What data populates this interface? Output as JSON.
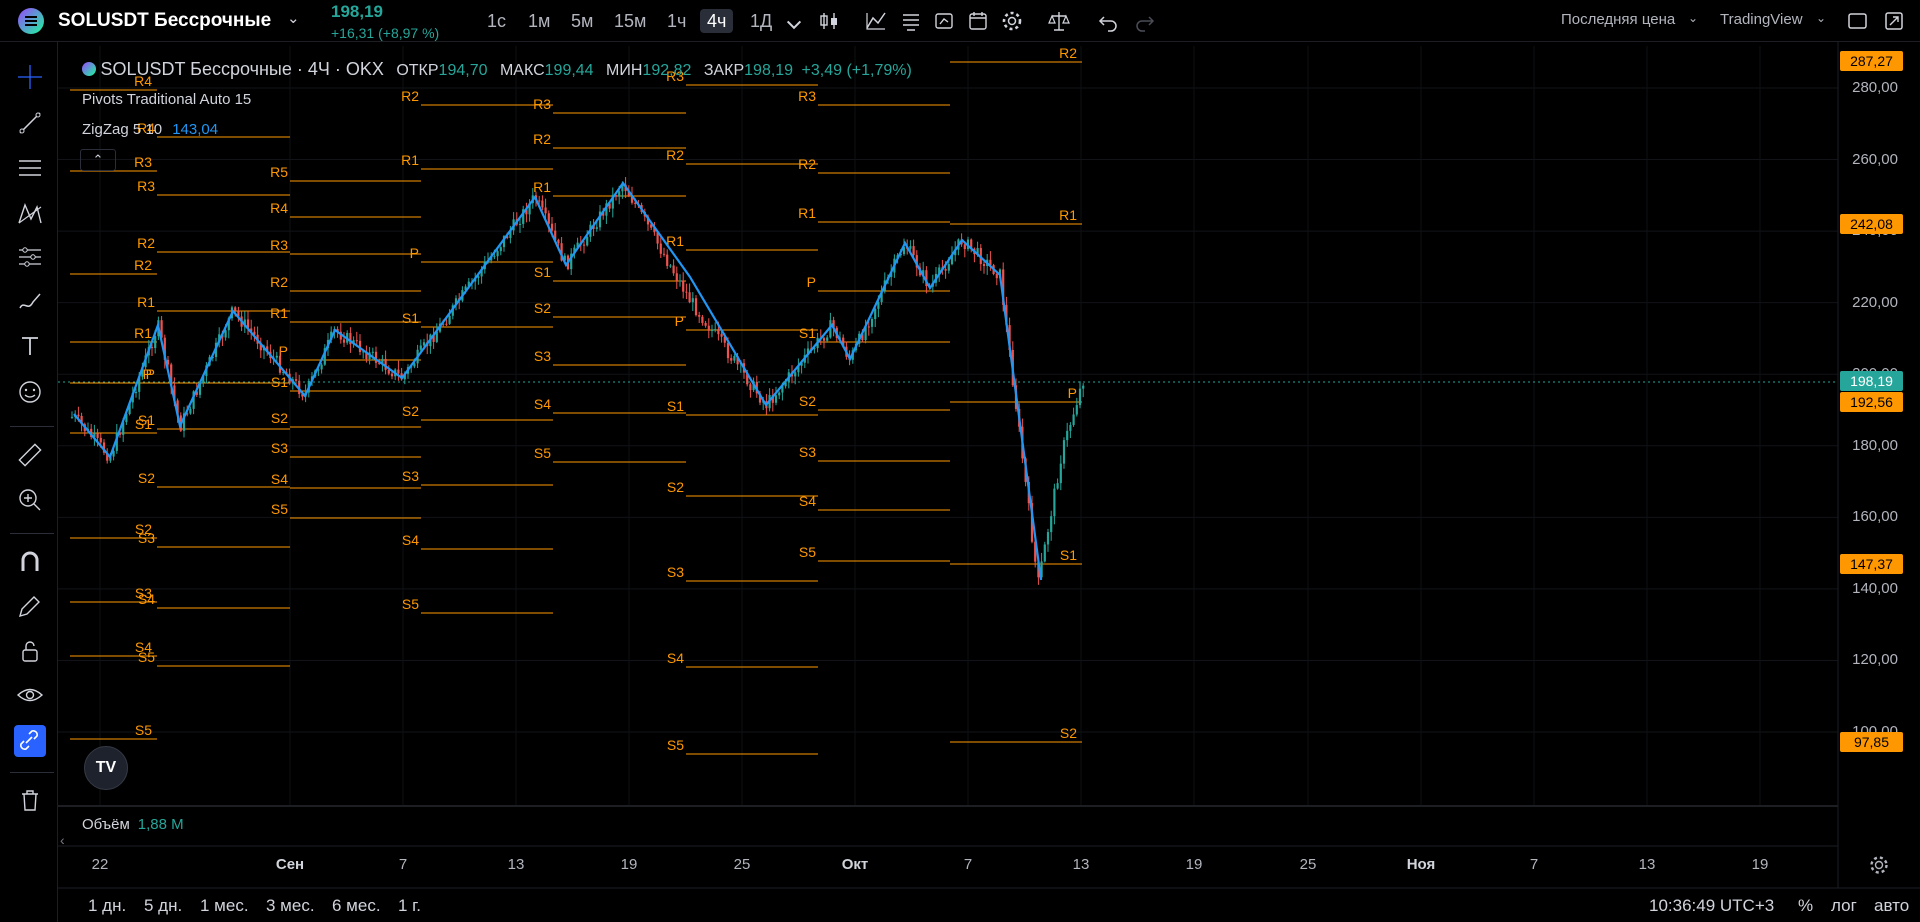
{
  "header": {
    "symbol": "SOLUSDT Бессрочные",
    "price": "198,19",
    "change": "+16,31 (+8,97 %)",
    "timeframes": [
      "1с",
      "1м",
      "5м",
      "15м",
      "1ч",
      "4ч",
      "1Д"
    ],
    "active_timeframe": "4ч",
    "price_type": "Последняя цена",
    "chart_provider": "TradingView"
  },
  "legend": {
    "title": "SOLUSDT Бессрочные · 4Ч · OKX",
    "open_label": "ОТКР",
    "open": "194,70",
    "high_label": "МАКС",
    "high": "199,44",
    "low_label": "МИН",
    "low": "192,82",
    "close_label": "ЗАКР",
    "close": "198,19",
    "close_change": "+3,49 (+1,79%)",
    "indicator_pivots": "Pivots Traditional Auto 15",
    "indicator_zigzag": "ZigZag 5 10",
    "zigzag_value": "143,04",
    "volume_label": "Объём",
    "volume_value": "1,88 M"
  },
  "price_axis": {
    "ticks": [
      "280,00",
      "260,00",
      "240,00",
      "220,00",
      "200,00",
      "180,00",
      "160,00",
      "140,00",
      "120,00",
      "100,00"
    ],
    "tags": [
      {
        "value": "287,27",
        "color": "#ff9800",
        "text_color": "#000"
      },
      {
        "value": "242,08",
        "color": "#ff9800",
        "text_color": "#000"
      },
      {
        "value": "198,19",
        "color": "#26a69a",
        "text_color": "#fff"
      },
      {
        "value": "192,56",
        "color": "#ff9800",
        "text_color": "#000"
      },
      {
        "value": "147,37",
        "color": "#ff9800",
        "text_color": "#000"
      },
      {
        "value": "97,85",
        "color": "#ff9800",
        "text_color": "#000"
      }
    ]
  },
  "time_axis": {
    "ticks": [
      "22",
      "Сен",
      "7",
      "13",
      "19",
      "25",
      "Окт",
      "7",
      "13",
      "19",
      "25",
      "Ноя",
      "7",
      "13",
      "19"
    ],
    "bold": [
      "Сен",
      "Окт",
      "Ноя"
    ]
  },
  "ranges": [
    "1 дн.",
    "5 дн.",
    "1 мес.",
    "3 мес.",
    "6 мес.",
    "1 г."
  ],
  "clock": "10:36:49 UTC+3",
  "bottom_right": {
    "percent": "%",
    "log": "лог",
    "auto": "авто"
  },
  "pivot_label_texts": [
    "R5",
    "R4",
    "R3",
    "R2",
    "R1",
    "P",
    "S1",
    "S2",
    "S3",
    "S4",
    "S5"
  ],
  "colors": {
    "pivot": "#ff9800",
    "zigzag": "#2196f3",
    "up": "#26a69a",
    "down": "#ef5350",
    "background": "#000000"
  }
}
